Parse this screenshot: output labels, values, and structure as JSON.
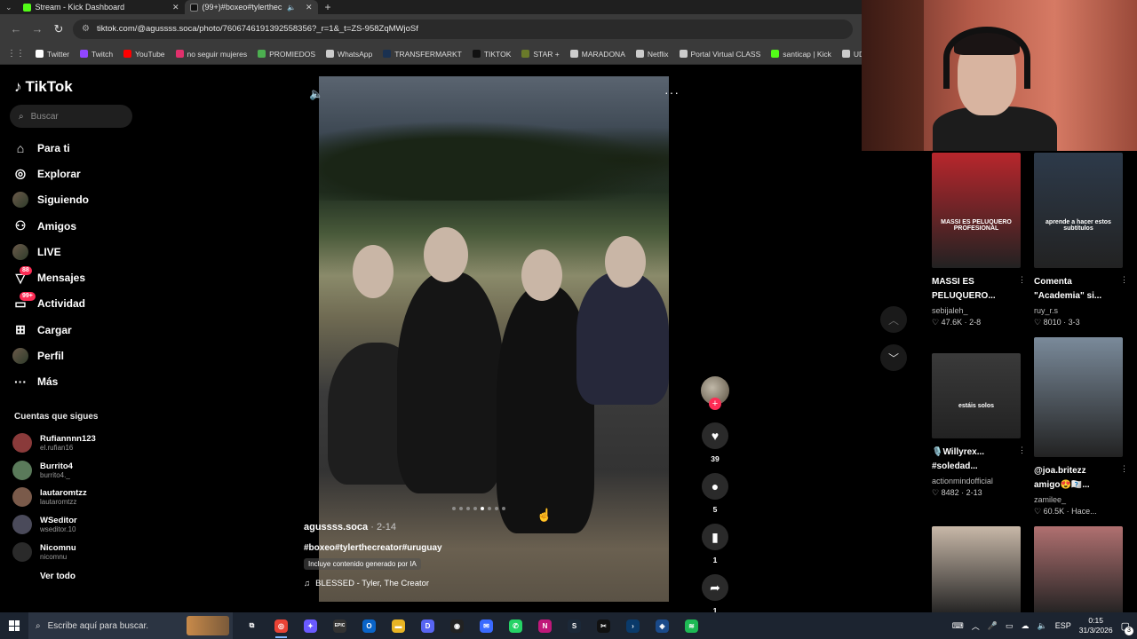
{
  "browser": {
    "tabs": [
      {
        "title": "Stream - Kick Dashboard",
        "favicon_color": "#53fc18",
        "active": false
      },
      {
        "title": "(99+)#boxeo#tylerthecreat",
        "favicon_color": "#111111",
        "active": true
      }
    ],
    "url": "tiktok.com/@agussss.soca/photo/7606746191392558356?_r=1&_t=ZS-958ZqMWjoSf",
    "bookmarks": [
      {
        "label": "Twitter",
        "icon": "x-icon",
        "color": "#ffffff"
      },
      {
        "label": "Twitch",
        "icon": "twitch-icon",
        "color": "#9146ff"
      },
      {
        "label": "YouTube",
        "icon": "youtube-icon",
        "color": "#ff0000"
      },
      {
        "label": "no seguir mujeres",
        "icon": "instagram-icon",
        "color": "#e1306c"
      },
      {
        "label": "PROMIEDOS",
        "icon": "promiedos-icon",
        "color": "#4caf50"
      },
      {
        "label": "WhatsApp",
        "icon": "globe-icon",
        "color": "#cccccc"
      },
      {
        "label": "TRANSFERMARKT",
        "icon": "transfermarkt-icon",
        "color": "#1a3151"
      },
      {
        "label": "TIKTOK",
        "icon": "tiktok-icon",
        "color": "#111111"
      },
      {
        "label": "STAR +",
        "icon": "star-icon",
        "color": "#6a7a2a"
      },
      {
        "label": "MARADONA",
        "icon": "globe-icon",
        "color": "#cccccc"
      },
      {
        "label": "Netflix",
        "icon": "globe-icon",
        "color": "#cccccc"
      },
      {
        "label": "Portal Virtual CLASS",
        "icon": "globe-icon",
        "color": "#cccccc"
      },
      {
        "label": "santicap | Kick",
        "icon": "kick-icon",
        "color": "#53fc18"
      },
      {
        "label": "UDE",
        "icon": "globe-icon",
        "color": "#cccccc"
      },
      {
        "label": "Supe",
        "icon": "super-icon",
        "color": "#e0201f"
      }
    ]
  },
  "tiktok": {
    "logo_text": "TikTok",
    "search_placeholder": "Buscar",
    "nav": [
      {
        "label": "Para ti",
        "icon": "home-icon",
        "glyph": "⌂"
      },
      {
        "label": "Explorar",
        "icon": "compass-icon",
        "glyph": "◎"
      },
      {
        "label": "Siguiendo",
        "icon": "following-icon",
        "glyph": "☻"
      },
      {
        "label": "Amigos",
        "icon": "friends-icon",
        "glyph": "⚇"
      },
      {
        "label": "LIVE",
        "icon": "live-icon",
        "glyph": "◉"
      },
      {
        "label": "Mensajes",
        "icon": "messages-icon",
        "glyph": "▽",
        "badge": "88"
      },
      {
        "label": "Actividad",
        "icon": "activity-icon",
        "glyph": "▭",
        "badge": "99+"
      },
      {
        "label": "Cargar",
        "icon": "upload-icon",
        "glyph": "⊞"
      },
      {
        "label": "Perfil",
        "icon": "profile-icon",
        "glyph": "●"
      },
      {
        "label": "Más",
        "icon": "more-icon",
        "glyph": "···"
      }
    ],
    "following_title": "Cuentas que sigues",
    "following": [
      {
        "name": "Rufiannnn123",
        "handle": "el.rufian16",
        "color": "#8a3a3a"
      },
      {
        "name": "Burrito4",
        "handle": "burrito4._",
        "color": "#5a7a5a"
      },
      {
        "name": "lautaromtzz",
        "handle": "lautaromtzz",
        "color": "#7a5a4a"
      },
      {
        "name": "WSeditor",
        "handle": "wseditor.10",
        "color": "#4a4a5a"
      },
      {
        "name": "Nicomnu",
        "handle": "nicomnu",
        "color": "#2a2a2a"
      }
    ],
    "see_all": "Ver todo",
    "post": {
      "username": "agussss.soca",
      "date": "2-14",
      "hashtags": "#boxeo#tylerthecreator#uruguay",
      "ai_label": "Incluye contenido generado por IA",
      "music": "BLESSED - Tyler, The Creator"
    },
    "actions": {
      "likes": "39",
      "comments": "5",
      "saves": "1",
      "shares": "1"
    },
    "suggestions": [
      {
        "title": "MASSI ES\nPELUQUERO...",
        "user": "sebijaleh_",
        "likes": "47.6K",
        "date": "2-8",
        "overlay": "MASSI ES PELUQUERO PROFESIONAL",
        "bg": "#b8262c"
      },
      {
        "title": "Comenta\n\"Academia\" si...",
        "user": "ruy_r.s",
        "likes": "8010",
        "date": "3-3",
        "overlay": "aprende a hacer estos subtítulos",
        "bg": "#2d3a4a"
      },
      {
        "title": "🎙️Willyrex...\n#soledad...",
        "user": "actionmindofficial",
        "likes": "8482",
        "date": "2-13",
        "overlay": "estáis solos",
        "bg": "#3a3a3a"
      },
      {
        "title": "@joa.britezz\namigo😍🇽🇽...",
        "user": "zamilee_",
        "likes": "60.5K",
        "date": "Hace...",
        "overlay": "",
        "bg": "#7a8a9a"
      },
      {
        "title": "",
        "user": "",
        "likes": "",
        "date": "",
        "overlay": "",
        "bg": "#c8b8a8"
      },
      {
        "title": "",
        "user": "",
        "likes": "",
        "date": "",
        "overlay": "",
        "bg": "#b07070"
      }
    ]
  },
  "taskbar": {
    "search_placeholder": "Escribe aquí para buscar.",
    "apps": [
      {
        "name": "task-view-icon",
        "glyph": "⧉",
        "color": "transparent"
      },
      {
        "name": "chrome-icon",
        "glyph": "◎",
        "color": "#ea4335"
      },
      {
        "name": "copilot-icon",
        "glyph": "✦",
        "color": "#6a5aff"
      },
      {
        "name": "epic-games-icon",
        "glyph": "EPIC",
        "color": "#333333"
      },
      {
        "name": "outlook-icon",
        "glyph": "O",
        "color": "#0a64c8"
      },
      {
        "name": "file-explorer-icon",
        "glyph": "▬",
        "color": "#e8b424"
      },
      {
        "name": "discord-icon",
        "glyph": "D",
        "color": "#5865f2"
      },
      {
        "name": "obs-icon",
        "glyph": "◉",
        "color": "#222222"
      },
      {
        "name": "messenger-icon",
        "glyph": "✉",
        "color": "#3a6aff"
      },
      {
        "name": "whatsapp-icon",
        "glyph": "✆",
        "color": "#25d366"
      },
      {
        "name": "onenote-icon",
        "glyph": "N",
        "color": "#c0187a"
      },
      {
        "name": "steam-icon",
        "glyph": "S",
        "color": "#1b2838"
      },
      {
        "name": "capcut-icon",
        "glyph": "✂",
        "color": "#111111"
      },
      {
        "name": "terminal-icon",
        "glyph": "›",
        "color": "#0a3a6a"
      },
      {
        "name": "security-icon",
        "glyph": "◈",
        "color": "#1a4a8a"
      },
      {
        "name": "spotify-icon",
        "glyph": "≋",
        "color": "#1db954"
      }
    ],
    "lang": "ESP",
    "time": "0:15",
    "date": "31/3/2026",
    "notifications": "3"
  }
}
